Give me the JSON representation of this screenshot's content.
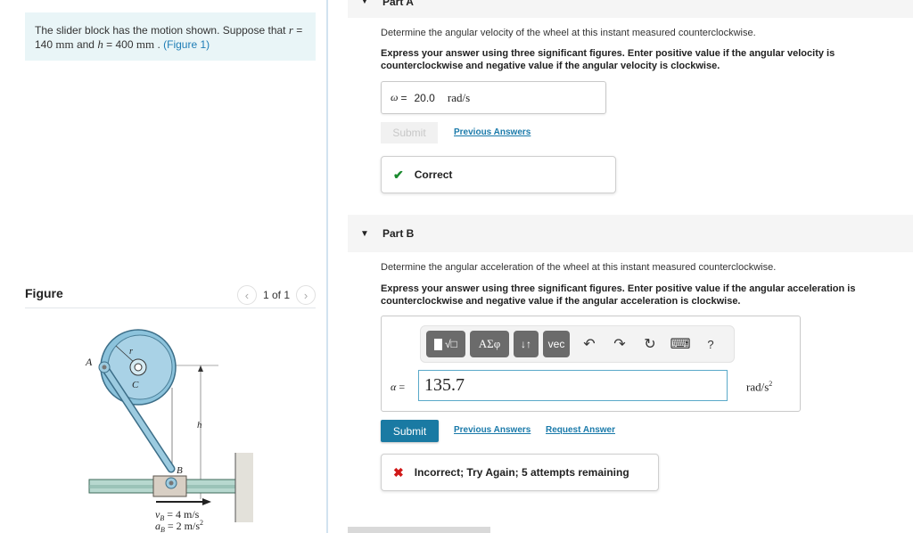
{
  "problem": {
    "text_before": "The slider block has the motion shown. Suppose that ",
    "r_symbol": "r",
    "eq": " = ",
    "r_value": "140",
    "unit_mm": "mm",
    "and": " and ",
    "h_symbol": "h",
    "h_value": "400",
    "period": " . ",
    "figure_link": "(Figure 1)"
  },
  "figure": {
    "title": "Figure",
    "pager_text": "1 of 1",
    "prev_icon": "‹",
    "next_icon": "›",
    "labels": {
      "A": "A",
      "C": "C",
      "r": "r",
      "h": "h",
      "B": "B",
      "vB": "v",
      "vB_sub": "B",
      "vB_rest": " = 4 m/s",
      "aB": "a",
      "aB_sub": "B",
      "aB_rest": " = 2 m/s",
      "aB_exp": "2"
    }
  },
  "partA": {
    "label": "Part A",
    "question": "Determine the angular velocity of the wheel at this instant measured counterclockwise.",
    "instructions": "Express your answer using three significant figures. Enter positive value if the angular velocity is counterclockwise and negative value if the angular velocity is clockwise.",
    "symbol": "ω",
    "equals": "=",
    "value": "20.0",
    "unit": "rad/s",
    "submit_label": "Submit",
    "previous_answers": "Previous Answers",
    "feedback_icon": "✔",
    "feedback": "Correct"
  },
  "partB": {
    "arrow": "▼",
    "label": "Part B",
    "question": "Determine the angular acceleration of the wheel at this instant measured counterclockwise.",
    "instructions": "Express your answer using three significant figures. Enter positive value if the angular acceleration is counterclockwise and negative value if the angular acceleration is clockwise.",
    "toolbar": {
      "templates": "√□",
      "greek": "ΑΣφ",
      "arrows": "↓↑",
      "vec": "vec",
      "undo": "↶",
      "redo": "↷",
      "reset": "↻",
      "keyboard": "⌨",
      "help": "?"
    },
    "symbol": "α",
    "equals": " =",
    "value": "135.7",
    "unit": "rad/s",
    "unit_exp": "2",
    "submit_label": "Submit",
    "previous_answers": "Previous Answers",
    "request_answer": "Request Answer",
    "feedback_icon": "✖",
    "feedback": "Incorrect; Try Again; 5 attempts remaining"
  }
}
